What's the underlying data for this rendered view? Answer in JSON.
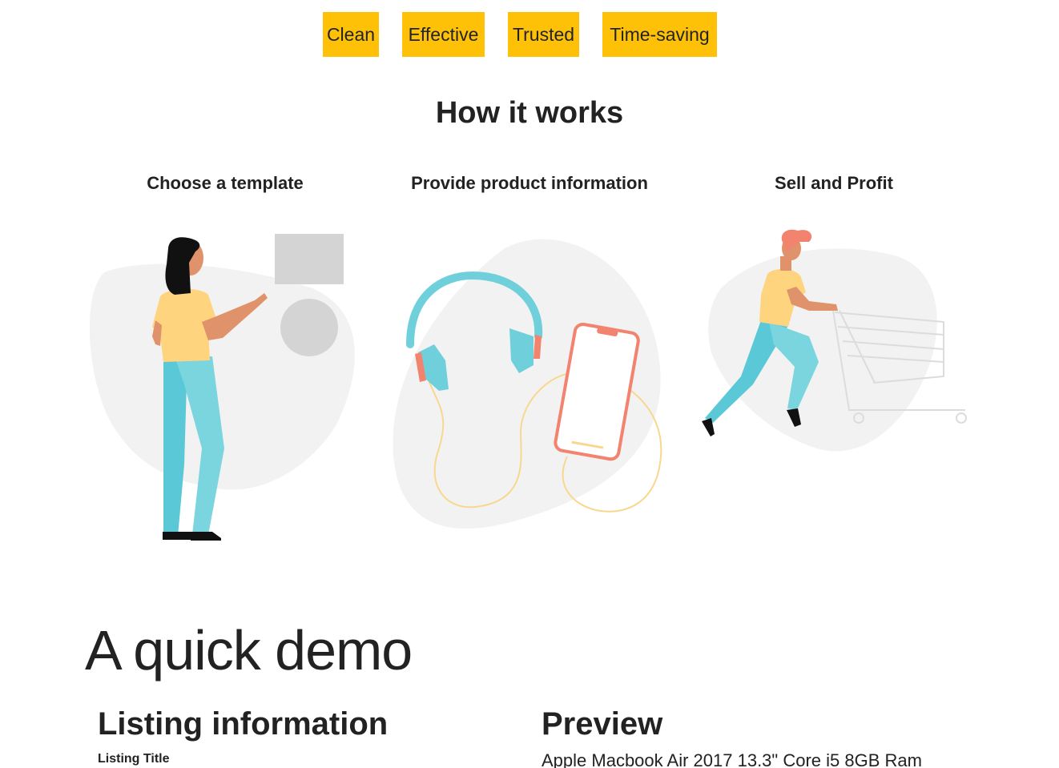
{
  "badges": [
    "Clean",
    "Effective",
    "Trusted",
    "Time-saving"
  ],
  "how_it_works": {
    "title": "How it works",
    "steps": [
      {
        "title": "Choose a template",
        "illustration": "woman-pointing-at-template-illustration"
      },
      {
        "title": "Provide product information",
        "illustration": "headphones-and-phone-illustration"
      },
      {
        "title": "Sell and Profit",
        "illustration": "man-pushing-shopping-cart-illustration"
      }
    ]
  },
  "demo": {
    "title": "A quick demo",
    "listing": {
      "title": "Listing information",
      "field_label": "Listing Title"
    },
    "preview": {
      "title": "Preview",
      "text": "Apple Macbook Air 2017 13.3\" Core i5 8GB Ram"
    }
  },
  "colors": {
    "badge": "#ffc107",
    "blob": "#f2f2f2",
    "skin": "#e0926a",
    "shirt": "#ffd47f",
    "pants": "#5bc8d7",
    "accent_orange": "#f2846f"
  }
}
